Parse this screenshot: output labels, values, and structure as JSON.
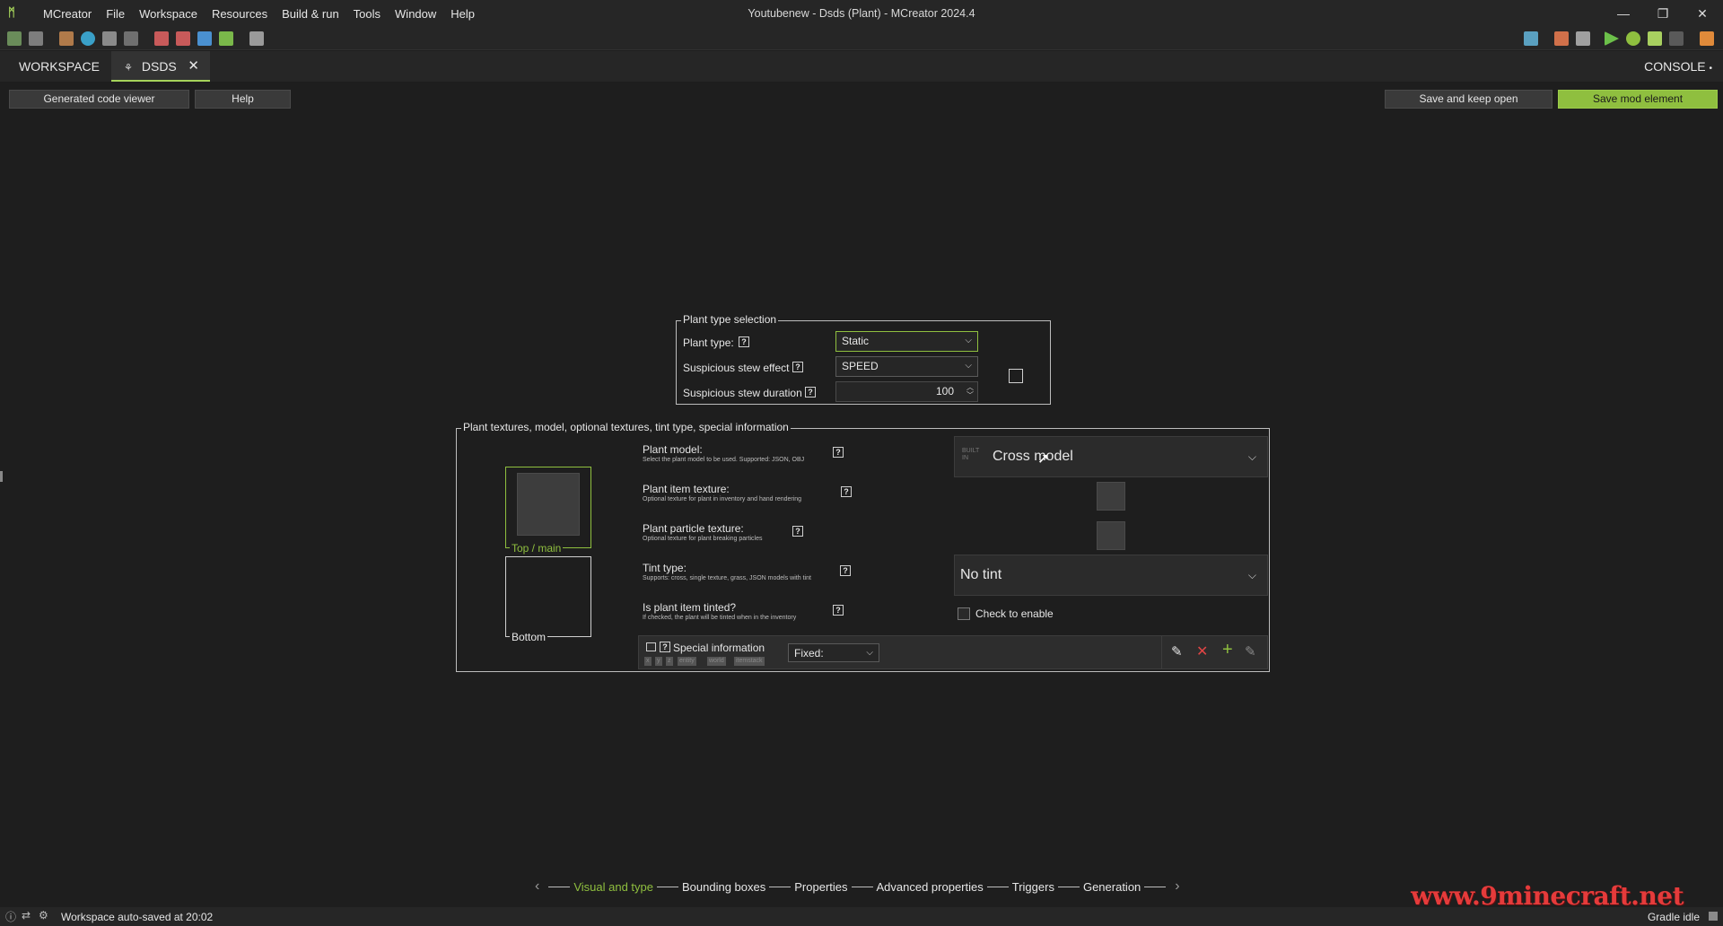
{
  "window": {
    "title": "Youtubenew - Dsds (Plant) - MCreator 2024.4",
    "minimize": "—",
    "restore": "❐",
    "close": "✕"
  },
  "menu": [
    "MCreator",
    "File",
    "Workspace",
    "Resources",
    "Build & run",
    "Tools",
    "Window",
    "Help"
  ],
  "tabs": {
    "workspace": "WORKSPACE",
    "element": "DSDS",
    "console": "CONSOLE"
  },
  "buttons": {
    "generated_code_viewer": "Generated code viewer",
    "help": "Help",
    "save_keep_open": "Save and keep open",
    "save_mod_element": "Save mod element"
  },
  "plant_type_selection": {
    "legend": "Plant type selection",
    "plant_type_label": "Plant type:",
    "plant_type_value": "Static",
    "stew_effect_label": "Suspicious stew effect",
    "stew_effect_value": "SPEED",
    "stew_duration_label": "Suspicious stew duration",
    "stew_duration_value": "100"
  },
  "textures_group": {
    "legend": "Plant textures, model, optional textures, tint type, special information",
    "top_main_label": "Top / main",
    "bottom_label": "Bottom",
    "plant_model_label": "Plant model:",
    "plant_model_sub": "Select the plant model to be used. Supported: JSON, OBJ",
    "plant_model_badge": "BUILT IN",
    "plant_model_value": "Cross model",
    "item_texture_label": "Plant item texture:",
    "item_texture_sub": "Optional texture for plant in inventory and hand rendering",
    "particle_texture_label": "Plant particle texture:",
    "particle_texture_sub": "Optional texture for plant breaking particles",
    "tint_type_label": "Tint type:",
    "tint_type_sub": "Supports: cross, single texture, grass, JSON models with tint",
    "tint_type_value": "No tint",
    "item_tinted_label": "Is plant item tinted?",
    "item_tinted_sub": "If checked, the plant will be tinted when in the inventory",
    "check_to_enable": "Check to enable",
    "special_info_label": "Special information",
    "special_info_mode": "Fixed:",
    "special_tags": [
      "x",
      "y",
      "z",
      "entity",
      "world",
      "itemstack"
    ]
  },
  "wizard_steps": [
    "Visual and type",
    "Bounding boxes",
    "Properties",
    "Advanced properties",
    "Triggers",
    "Generation"
  ],
  "status": {
    "message": "Workspace auto-saved at 20:02",
    "gradle": "Gradle idle"
  },
  "watermark": "www.9minecraft.net",
  "colors": {
    "accent": "#8fbf3f",
    "background": "#1e1e1e",
    "panel": "#262626"
  }
}
